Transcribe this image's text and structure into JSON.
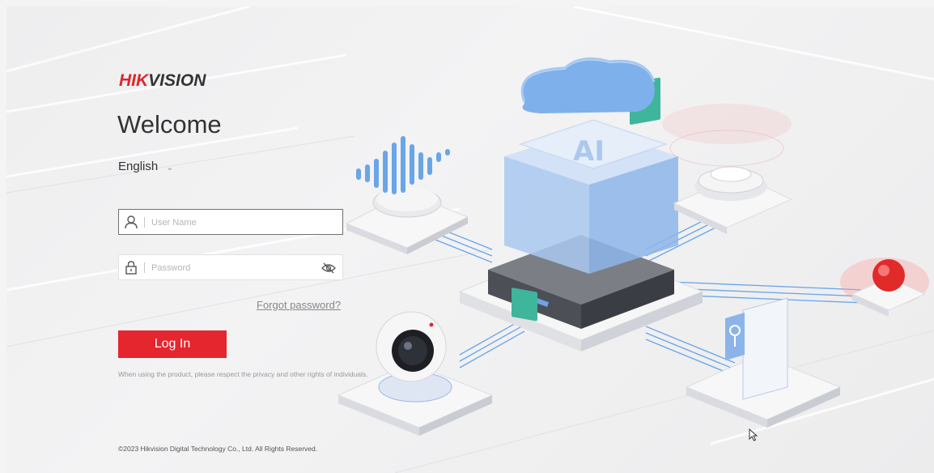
{
  "brand": {
    "part1": "HIK",
    "part2": "VISION"
  },
  "welcome": "Welcome",
  "language": {
    "selected": "English"
  },
  "username": {
    "placeholder": "User Name",
    "value": ""
  },
  "password": {
    "placeholder": "Password",
    "value": ""
  },
  "forgot_password": "Forgot password?",
  "login_button": "Log In",
  "privacy_notice": "When using the product, please respect the privacy and other rights of individuals.",
  "copyright": "©2023 Hikvision Digital Technology Co., Ltd. All Rights Reserved.",
  "colors": {
    "brand_red": "#e0242b",
    "button_red": "#e5262e",
    "accent_blue": "#4a90e2"
  },
  "icons": [
    "user-icon",
    "lock-icon",
    "eye-hidden-icon",
    "chevron-down-icon",
    "mouse-cursor-icon"
  ]
}
